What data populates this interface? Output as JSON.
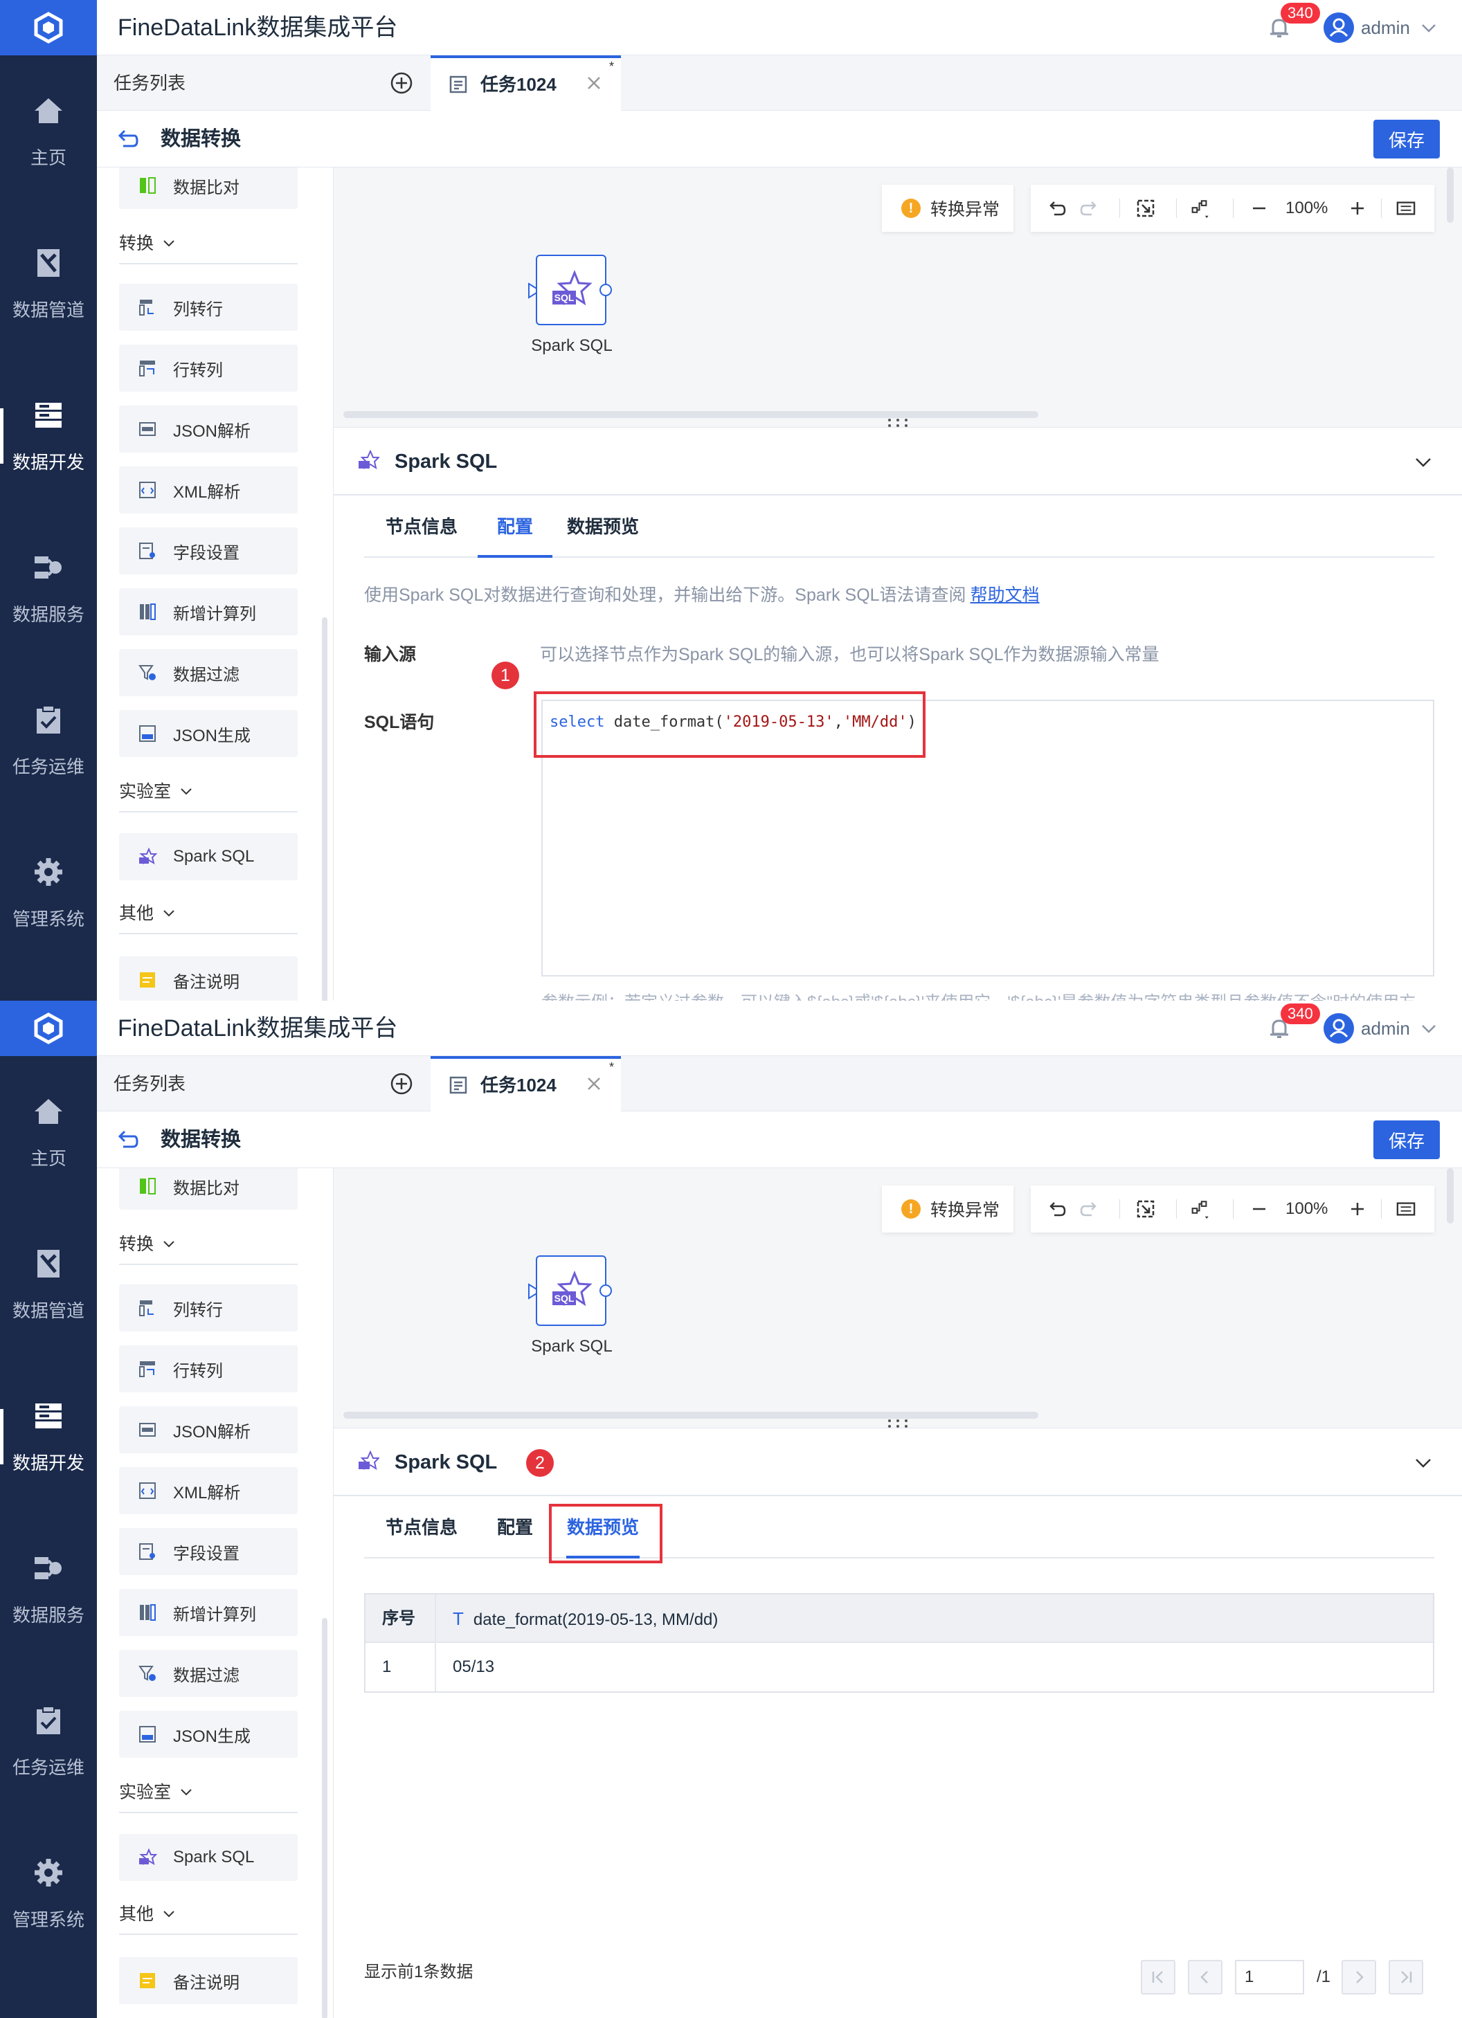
{
  "app": {
    "title": "FineDataLink数据集成平台",
    "notification_count": "340",
    "username": "admin"
  },
  "nav": [
    {
      "label": "主页",
      "icon": "home-icon"
    },
    {
      "label": "数据管道",
      "icon": "pipeline-icon"
    },
    {
      "label": "数据开发",
      "icon": "dev-icon"
    },
    {
      "label": "数据服务",
      "icon": "service-icon"
    },
    {
      "label": "任务运维",
      "icon": "ops-icon"
    },
    {
      "label": "管理系统",
      "icon": "gear-icon"
    }
  ],
  "tabs": {
    "task_list": "任务列表",
    "active_tab": "任务1024",
    "modified_marker": "*"
  },
  "header": {
    "title": "数据转换",
    "save": "保存"
  },
  "sidebar": {
    "top_item": "数据比对",
    "groups": {
      "transform": "转换",
      "lab": "实验室",
      "other": "其他"
    },
    "transform_items": [
      "列转行",
      "行转列",
      "JSON解析",
      "XML解析",
      "字段设置",
      "新增计算列",
      "数据过滤",
      "JSON生成"
    ],
    "lab_items": [
      "Spark SQL"
    ],
    "other_items": [
      "备注说明"
    ]
  },
  "canvas": {
    "warning": "转换异常",
    "zoom": "100%",
    "node_label": "Spark SQL",
    "node_badge": "SQL"
  },
  "panel": {
    "title": "Spark SQL",
    "tabs": [
      "节点信息",
      "配置",
      "数据预览"
    ],
    "description": "使用Spark SQL对数据进行查询和处理，并输出给下游。Spark SQL语法请查阅",
    "help_link": "帮助文档",
    "input_label": "输入源",
    "input_hint": "可以选择节点作为Spark SQL的输入源，也可以将Spark SQL作为数据源输入常量",
    "sql_label": "SQL语句",
    "sql_keyword": "select",
    "sql_function": " date_format(",
    "sql_arg1": "'2019-05-13'",
    "sql_comma": ",",
    "sql_arg2": "'MM/dd'",
    "sql_close": ")",
    "bottom_hint": "参数示例：若定义过参数，可以键入${abc}或'${abc}'来使用它，'${abc}'是参数值为字符串类型且参数值不含\"时的使用方"
  },
  "markers": {
    "step1": "1",
    "step2": "2"
  },
  "preview": {
    "col_index": "序号",
    "col_name": "date_format(2019-05-13, MM/dd)",
    "col_type_icon": "T",
    "rows": [
      {
        "index": "1",
        "value": "05/13"
      }
    ],
    "footer": "显示前1条数据",
    "page_value": "1",
    "page_total": "/1"
  }
}
